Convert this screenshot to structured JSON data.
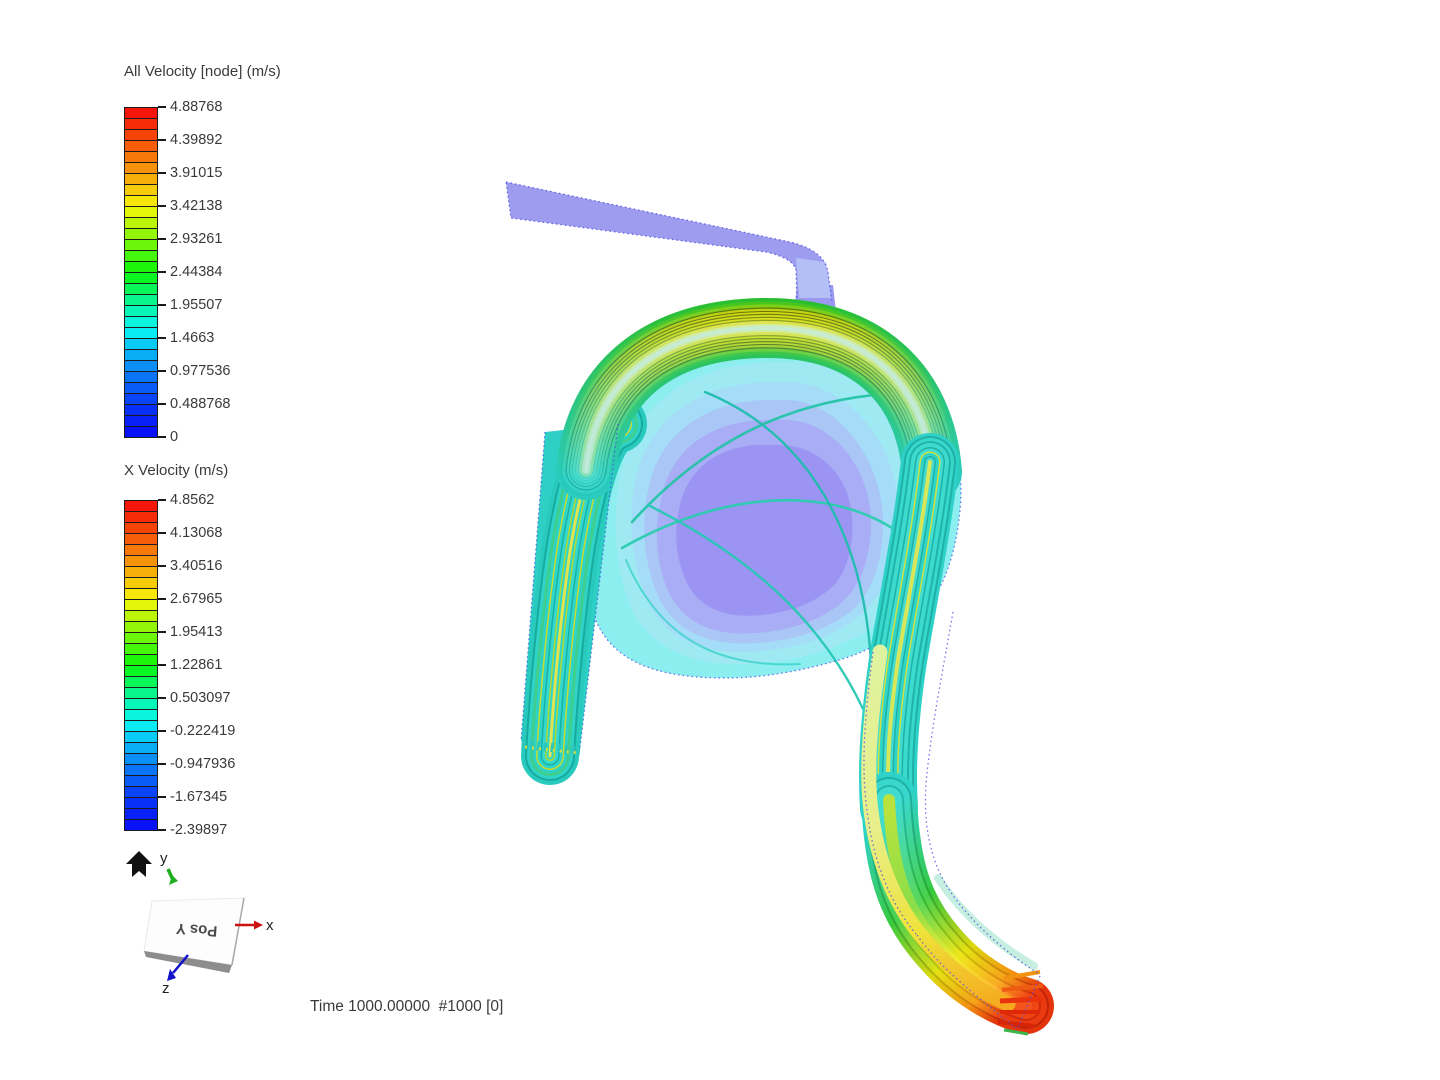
{
  "window": {
    "background": "#ffffff"
  },
  "legends": [
    {
      "id": "all_velocity",
      "title": "All Velocity [node] (m/s)",
      "segments": 30,
      "ticks": [
        "4.88768",
        "4.39892",
        "3.91015",
        "3.42138",
        "2.93261",
        "2.44384",
        "1.95507",
        "1.4663",
        "0.977536",
        "0.488768",
        "0"
      ]
    },
    {
      "id": "x_velocity",
      "title": "X Velocity (m/s)",
      "segments": 30,
      "ticks": [
        "4.8562",
        "4.13068",
        "3.40516",
        "2.67965",
        "1.95413",
        "1.22861",
        "0.503097",
        "-0.222419",
        "-0.947936",
        "-1.67345",
        "-2.39897"
      ]
    }
  ],
  "triad": {
    "plane_label": "Pos Y",
    "axis_x": {
      "label": "x",
      "color": "#cc1111"
    },
    "axis_y": {
      "label": "y",
      "color": "#1fae1f"
    },
    "axis_z": {
      "label": "z",
      "color": "#1111cc"
    }
  },
  "statusbar": {
    "time_label": "Time 1000.00000  #1000 [0]"
  },
  "colors": {
    "colormap_hue_anchors": [
      [
        0,
        240
      ],
      [
        0.1,
        228
      ],
      [
        0.2,
        210
      ],
      [
        0.3,
        187
      ],
      [
        0.4,
        160
      ],
      [
        0.5,
        120
      ],
      [
        0.6,
        90
      ],
      [
        0.7,
        60
      ],
      [
        0.8,
        38
      ],
      [
        0.9,
        18
      ],
      [
        1,
        0
      ]
    ],
    "segment_border": "#1b1b1b",
    "label_text": "#3a3a3a",
    "inlet_fill": "#9d9cee",
    "bulb_fill": "#8deef0",
    "bulb_center": "#9b94f2",
    "streamline_teal": "#2ccdb0",
    "outlet_red": "#e3340c",
    "edge_dots": "#4f4fe2"
  }
}
